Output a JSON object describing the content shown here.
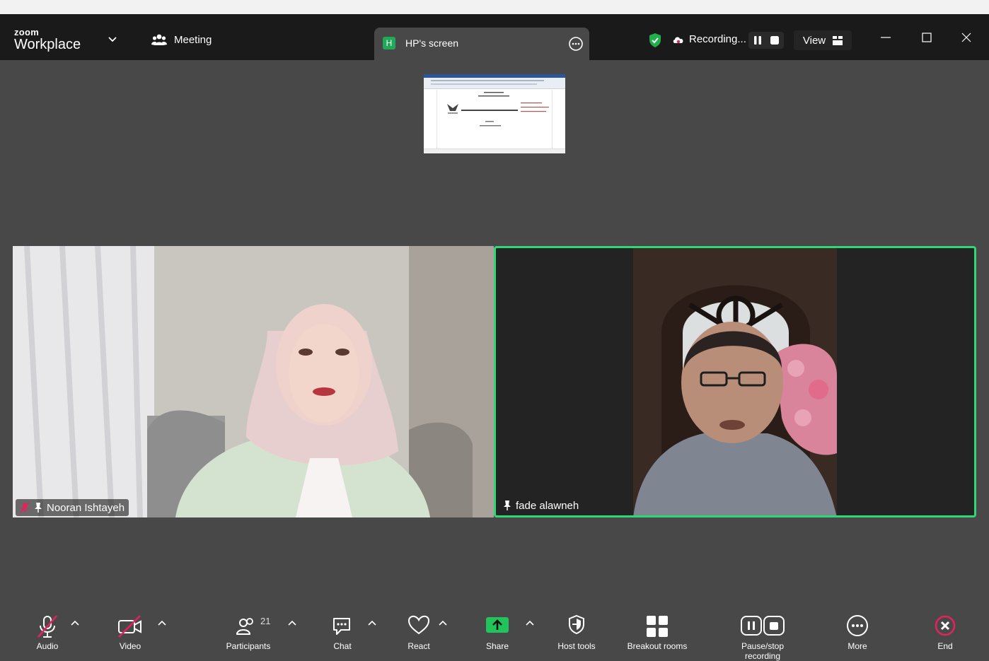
{
  "app": {
    "brand_small": "zoom",
    "brand_name": "Workplace"
  },
  "header": {
    "meeting_label": "Meeting",
    "share_tab": {
      "badge": "H",
      "label": "HP's screen"
    },
    "recording_label": "Recording...",
    "view_label": "View"
  },
  "participants": [
    {
      "name": "Nooran Ishtayeh",
      "muted": true,
      "pinned": true
    },
    {
      "name": "fade alawneh",
      "muted": false,
      "pinned": true,
      "active_speaker": true
    }
  ],
  "toolbar": {
    "participants_count": "21",
    "items": [
      {
        "icon": "mic-muted-icon",
        "label": "Audio"
      },
      {
        "icon": "video-off-icon",
        "label": "Video"
      },
      {
        "icon": "participants-icon",
        "label": "Participants"
      },
      {
        "icon": "chat-icon",
        "label": "Chat"
      },
      {
        "icon": "react-icon",
        "label": "React"
      },
      {
        "icon": "share-icon",
        "label": "Share"
      },
      {
        "icon": "host-tools-icon",
        "label": "Host tools"
      },
      {
        "icon": "breakout-rooms-icon",
        "label": "Breakout rooms"
      },
      {
        "icon": "recording-controls-icon",
        "label": "Pause/stop recording"
      },
      {
        "icon": "more-icon",
        "label": "More"
      },
      {
        "icon": "end-icon",
        "label": "End"
      }
    ]
  },
  "colors": {
    "active_speaker_border": "#2fd877",
    "share_green": "#21a95a",
    "end_red": "#e0245e",
    "bg": "#484848"
  }
}
